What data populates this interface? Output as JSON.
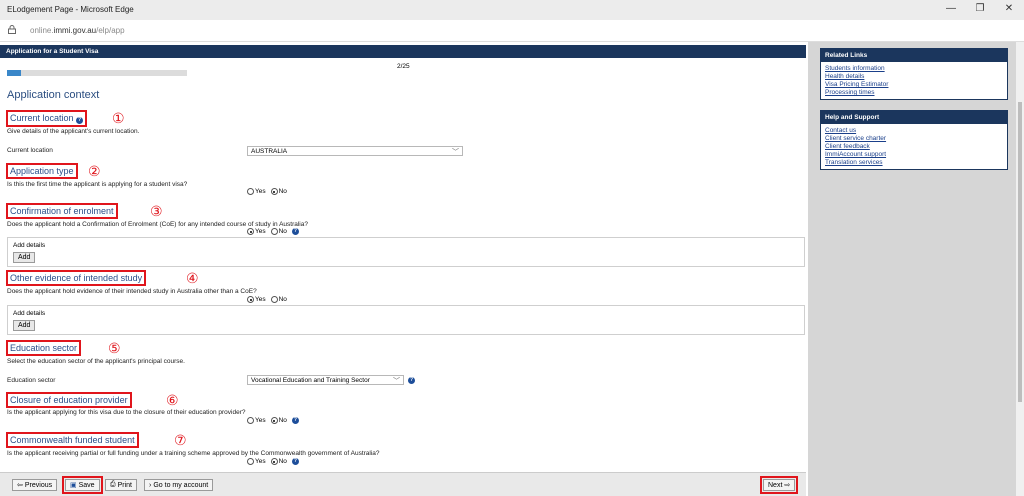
{
  "window": {
    "title": "ELodgement Page - Microsoft Edge",
    "controls": {
      "minimize": "—",
      "restore": "❐",
      "close": "✕"
    }
  },
  "address": {
    "url_prefix": "online.",
    "url_domain": "immi.gov.au",
    "url_path": "/elp/app"
  },
  "header": {
    "title": "Application for a Student Visa"
  },
  "progress": {
    "label": "2/25",
    "fraction": 0.08
  },
  "page_heading": "Application context",
  "sections": {
    "current_location": {
      "number": "①",
      "title": "Current location",
      "desc": "Give details of the applicant's current location.",
      "field_label": "Current location",
      "field_value": "AUSTRALIA"
    },
    "application_type": {
      "number": "②",
      "title": "Application type",
      "question": "Is this the first time the applicant is applying for a student visa?",
      "yes": "Yes",
      "no": "No",
      "selected": "no"
    },
    "coe": {
      "number": "③",
      "title": "Confirmation of enrolment",
      "question": "Does the applicant hold a Confirmation of Enrolment (CoE) for any intended course of study in Australia?",
      "yes": "Yes",
      "no": "No",
      "selected": "yes",
      "details_label": "Add details",
      "add_label": "Add"
    },
    "other_evidence": {
      "number": "④",
      "title": "Other evidence of intended study",
      "question": "Does the applicant hold evidence of their intended study in Australia other than a CoE?",
      "yes": "Yes",
      "no": "No",
      "selected": "yes",
      "details_label": "Add details",
      "add_label": "Add"
    },
    "education_sector": {
      "number": "⑤",
      "title": "Education sector",
      "desc": "Select the education sector of the applicant's principal course.",
      "field_label": "Education sector",
      "field_value": "Vocational Education and Training Sector"
    },
    "closure": {
      "number": "⑥",
      "title": "Closure of education provider",
      "question": "Is the applicant applying for this visa due to the closure of their education provider?",
      "yes": "Yes",
      "no": "No",
      "selected": "no"
    },
    "commonwealth": {
      "number": "⑦",
      "title": "Commonwealth funded student",
      "question": "Is the applicant receiving partial or full funding under a training scheme approved by the Commonwealth government of Australia?",
      "yes": "Yes",
      "no": "No",
      "selected": "no"
    }
  },
  "footer": {
    "previous": "Previous",
    "save": "Save",
    "print": "Print",
    "account": "Go to my account",
    "next": "Next"
  },
  "sidebar": {
    "related_links": {
      "title": "Related Links",
      "items": [
        "Students information",
        "Health details",
        "Visa Pricing Estimator",
        "Processing times"
      ]
    },
    "help_support": {
      "title": "Help and Support",
      "items": [
        "Contact us",
        "Client service charter",
        "Client feedback",
        "ImmiAccount support",
        "Translation services"
      ]
    }
  },
  "colors": {
    "header": "#1b365d",
    "highlight": "#e0151c",
    "link": "#1a3f8a",
    "progress": "#3a87c9"
  },
  "icons": [
    "lock-icon",
    "help-icon",
    "save-icon",
    "print-icon",
    "arrow-left-icon",
    "arrow-right-icon",
    "chevron-down-icon"
  ]
}
